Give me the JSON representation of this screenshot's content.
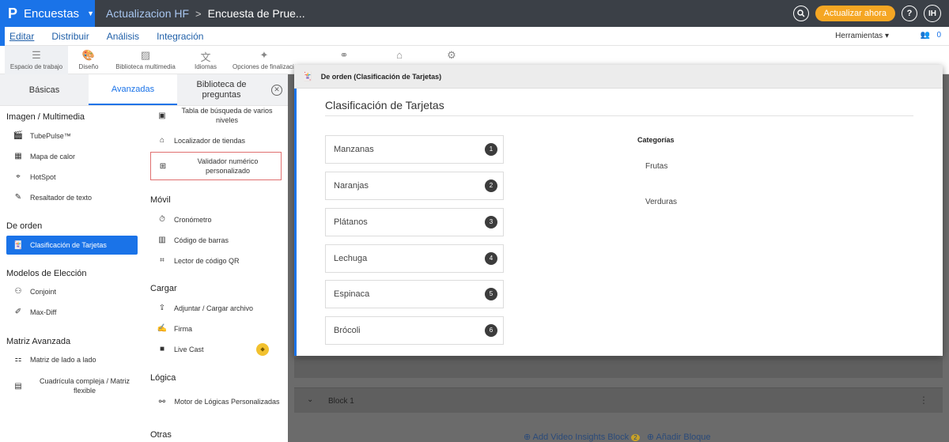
{
  "topbar": {
    "logo_letter": "P",
    "app_name": "Encuestas",
    "project": "Actualizacion HF",
    "breadcrumb_sep": ">",
    "survey": "Encuesta de Prue...",
    "upgrade_label": "Actualizar ahora",
    "help_label": "?",
    "avatar_initials": "IH"
  },
  "menu": {
    "items": [
      "Editar",
      "Distribuir",
      "Análisis",
      "Integración"
    ],
    "tools_label": "Herramientas",
    "users_count": "0"
  },
  "toolbar": {
    "items": [
      "Espacio de trabajo",
      "Diseño",
      "Biblioteca multimedia",
      "Idiomas",
      "Opciones de finalización"
    ]
  },
  "tabs": {
    "basic": "Básicas",
    "advanced": "Avanzadas",
    "library": "Biblioteca de preguntas"
  },
  "left_col": {
    "sections": [
      {
        "title": "Imagen / Multimedia",
        "items": [
          "TubePulse™",
          "Mapa de calor",
          "HotSpot",
          "Resaltador de texto"
        ]
      },
      {
        "title": "De orden",
        "items": [
          "Clasificación de Tarjetas"
        ]
      },
      {
        "title": "Modelos de Elección",
        "items": [
          "Conjoint",
          "Max-Diff"
        ]
      },
      {
        "title": "Matriz Avanzada",
        "items": [
          "Matriz de lado a lado",
          "Cuadrícula compleja / Matriz flexible"
        ]
      }
    ]
  },
  "right_col": {
    "top_items": [
      "Tabla de búsqueda de varios niveles",
      "Localizador de tiendas",
      "Validador numérico personalizado"
    ],
    "sections": [
      {
        "title": "Móvil",
        "items": [
          "Cronómetro",
          "Código de barras",
          "Lector de código QR"
        ]
      },
      {
        "title": "Cargar",
        "items": [
          "Adjuntar / Cargar archivo",
          "Firma",
          "Live Cast"
        ]
      },
      {
        "title": "Lógica",
        "items": [
          "Motor de Lógicas Personalizadas"
        ]
      },
      {
        "title": "Otras"
      }
    ]
  },
  "card": {
    "header": "De orden (Clasificación de Tarjetas)",
    "question_title": "Clasificación de Tarjetas",
    "items": [
      {
        "label": "Manzanas",
        "num": "1"
      },
      {
        "label": "Naranjas",
        "num": "2"
      },
      {
        "label": "Plátanos",
        "num": "3"
      },
      {
        "label": "Lechuga",
        "num": "4"
      },
      {
        "label": "Espinaca",
        "num": "5"
      },
      {
        "label": "Brócoli",
        "num": "6"
      }
    ],
    "categories_header": "Categorías",
    "categories": [
      "Frutas",
      "Verduras"
    ]
  },
  "block": {
    "label": "Block 1",
    "add_video": "Add Video Insights Block",
    "add_video_badge": "2",
    "add_block": "Añadir Bloque"
  }
}
